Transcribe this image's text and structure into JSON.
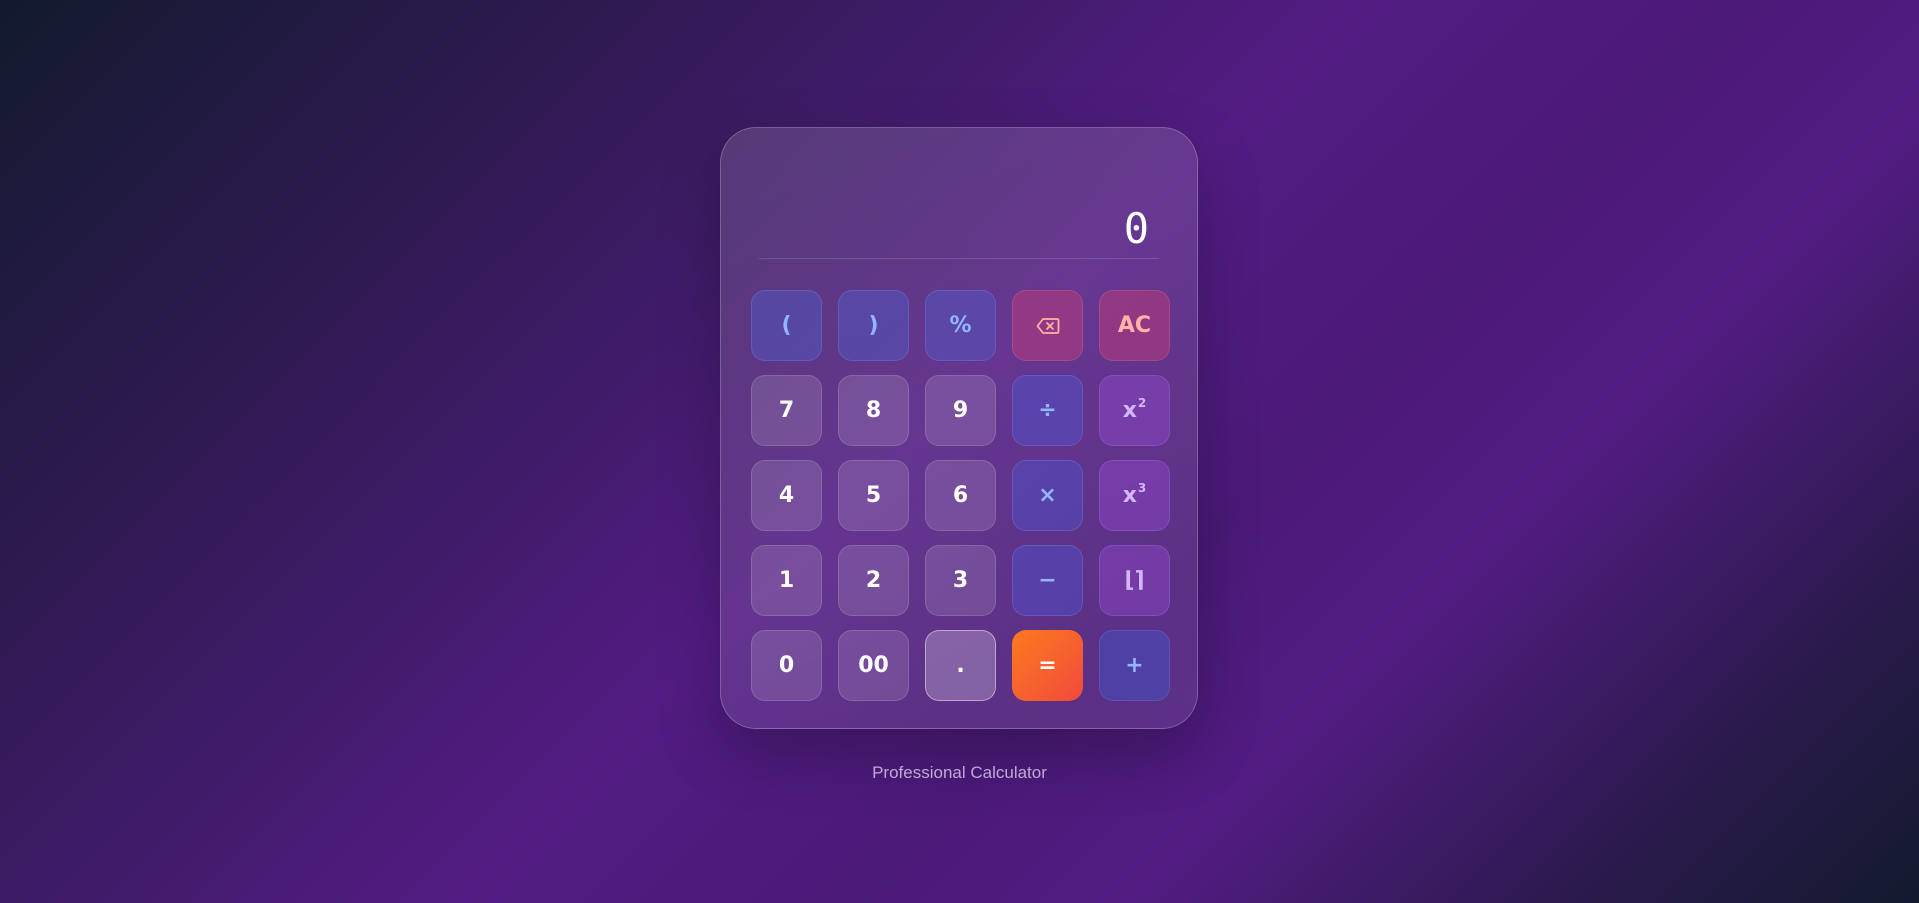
{
  "display": {
    "value": "0"
  },
  "keys": {
    "open_paren": "(",
    "close_paren": ")",
    "percent": "%",
    "backspace_icon": "backspace-icon",
    "clear": "AC",
    "seven": "7",
    "eight": "8",
    "nine": "9",
    "divide": "÷",
    "square_base": "x",
    "square_exp": "2",
    "four": "4",
    "five": "5",
    "six": "6",
    "multiply": "×",
    "cube_base": "x",
    "cube_exp": "3",
    "one": "1",
    "two": "2",
    "three": "3",
    "minus": "−",
    "floor": "⌊⌉",
    "zero": "0",
    "double_zero": "00",
    "decimal": ".",
    "equals": "=",
    "plus": "+"
  },
  "caption": "Professional Calculator",
  "colors": {
    "equals_gradient_start": "#fb7a1f",
    "equals_gradient_end": "#f24a3d",
    "operator_text": "#93b4ff",
    "clear_text": "#ffb3a8",
    "scientific_text": "#d3b6ff"
  }
}
